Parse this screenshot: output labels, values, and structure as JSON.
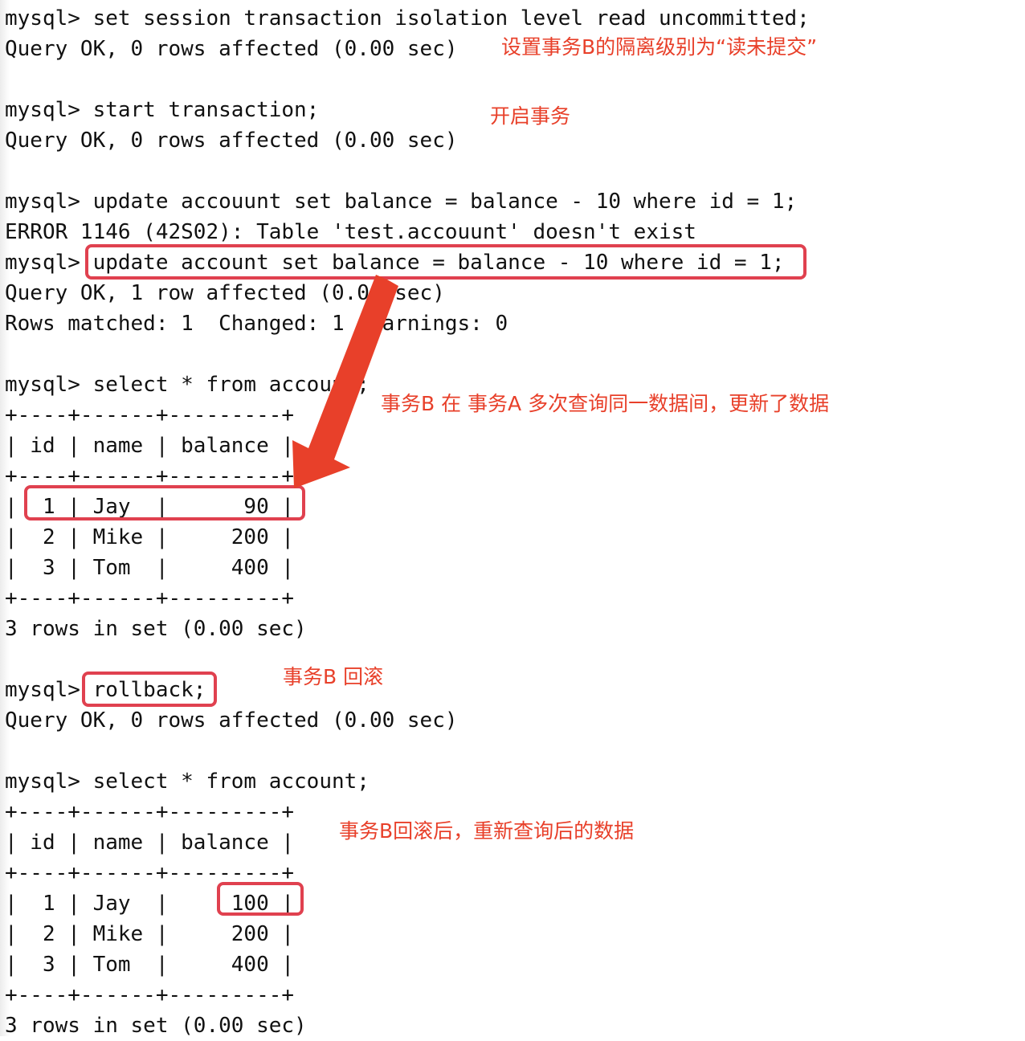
{
  "terminal": {
    "lines": [
      "mysql> set session transaction isolation level read uncommitted;",
      "Query OK, 0 rows affected (0.00 sec)",
      "",
      "mysql> start transaction;",
      "Query OK, 0 rows affected (0.00 sec)",
      "",
      "mysql> update accouunt set balance = balance - 10 where id = 1;",
      "ERROR 1146 (42S02): Table 'test.accouunt' doesn't exist",
      "mysql> update account set balance = balance - 10 where id = 1;",
      "Query OK, 1 row affected (0.00 sec)",
      "Rows matched: 1  Changed: 1  Warnings: 0",
      "",
      "mysql> select * from account;",
      "+----+------+---------+",
      "| id | name | balance |",
      "+----+------+---------+",
      "|  1 | Jay  |      90 |",
      "|  2 | Mike |     200 |",
      "|  3 | Tom  |     400 |",
      "+----+------+---------+",
      "3 rows in set (0.00 sec)",
      "",
      "mysql> rollback;",
      "Query OK, 0 rows affected (0.00 sec)",
      "",
      "mysql> select * from account;",
      "+----+------+---------+",
      "| id | name | balance |",
      "+----+------+---------+",
      "|  1 | Jay  |     100 |",
      "|  2 | Mike |     200 |",
      "|  3 | Tom  |     400 |",
      "+----+------+---------+",
      "3 rows in set (0.00 sec)"
    ]
  },
  "annotations": {
    "isolation_level": "设置事务B的隔离级别为“读未提交”",
    "start_transaction": "开启事务",
    "dirty_update": "事务B 在 事务A 多次查询同一数据间，更新了数据",
    "rollback": "事务B 回滚",
    "after_rollback": "事务B回滚后，重新查询后的数据"
  },
  "colors": {
    "annotation_text": "#e8402a",
    "highlight_border": "#e0414f",
    "arrow": "#e8402a"
  }
}
